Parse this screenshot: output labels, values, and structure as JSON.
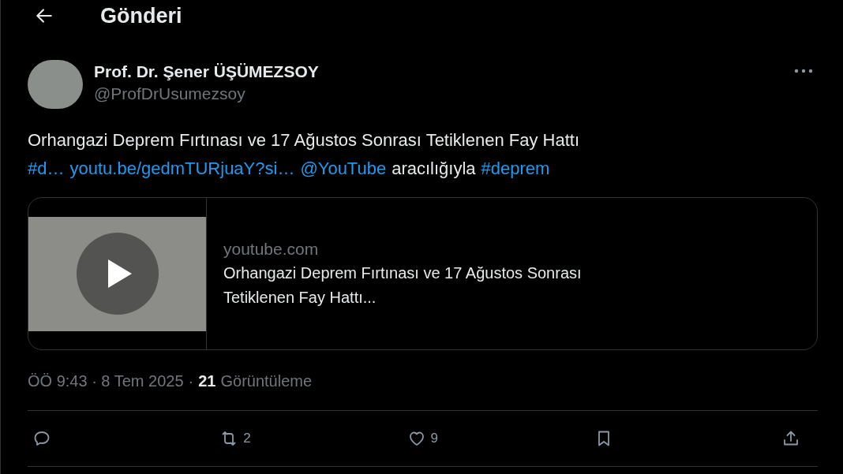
{
  "header": {
    "title": "Gönderi"
  },
  "post": {
    "author": {
      "name": "Prof. Dr. Şener ÜŞÜMEZSOY",
      "handle": "@ProfDrUsumezsoy"
    },
    "text_lines": [
      [
        {
          "kind": "text",
          "text": "Orhangazi Deprem Fırtınası ve 17 Ağustos Sonrası Tetiklenen Fay Hattı"
        }
      ],
      [
        {
          "kind": "link",
          "text": "#d…"
        },
        {
          "kind": "link",
          "text": "youtu.be/gedmTURjuaY?si…"
        },
        {
          "kind": "link",
          "text": "@YouTube"
        },
        {
          "kind": "text",
          "text": "aracılığıyla"
        },
        {
          "kind": "link",
          "text": "#deprem"
        }
      ]
    ],
    "link_card": {
      "domain": "youtube.com",
      "title_lines": [
        "Orhangazi Deprem Fırtınası ve 17 Ağustos Sonrası",
        "Tetiklenen Fay Hattı..."
      ]
    },
    "meta": {
      "timestamp": "ÖÖ 9:43 · 8 Tem 2025",
      "separator": "·",
      "views_count": "21",
      "views_label": "Görüntüleme"
    },
    "actions": [
      {
        "kind": "reply"
      },
      {
        "kind": "repost",
        "count": "2"
      },
      {
        "kind": "like",
        "count": "9"
      },
      {
        "kind": "bookmark"
      },
      {
        "kind": "share"
      }
    ]
  }
}
